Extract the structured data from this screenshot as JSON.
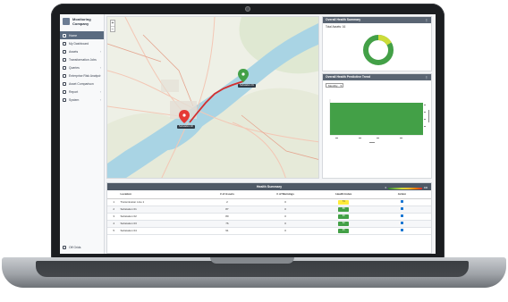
{
  "app": {
    "title": "Monitoring Company"
  },
  "sidebar": {
    "items": [
      {
        "label": "Home",
        "active": true,
        "has_children": false
      },
      {
        "label": "My Dashboard",
        "active": false,
        "has_children": false
      },
      {
        "label": "Assets",
        "active": false,
        "has_children": true
      },
      {
        "label": "Transformation Jobs",
        "active": false,
        "has_children": false
      },
      {
        "label": "Queries",
        "active": false,
        "has_children": true
      },
      {
        "label": "Enterprise Risk Analysis",
        "active": false,
        "has_children": true
      },
      {
        "label": "Asset Comparison",
        "active": false,
        "has_children": false
      },
      {
        "label": "Report",
        "active": false,
        "has_children": true
      },
      {
        "label": "System",
        "active": false,
        "has_children": true
      }
    ],
    "footer_label": "Off Grids"
  },
  "map": {
    "zoom_in": "+",
    "zoom_out": "−",
    "pins": [
      {
        "label": "Substation 01",
        "color": "#43a047"
      },
      {
        "label": "Substation 02",
        "color": "#e53935"
      }
    ]
  },
  "health_summary_card": {
    "title": "Overall Health Summary",
    "caption": "Total Assets: 16",
    "menu_icon": "more-icon",
    "donut": {
      "good": 13,
      "fair": 3,
      "colors": {
        "good": "#43a047",
        "fair": "#cddc39"
      }
    }
  },
  "health_trend_card": {
    "title": "Overall Health Predictive Trend",
    "menu_icon": "more-icon",
    "select_value": "Monthly",
    "bar_color": "#43a047"
  },
  "health_table": {
    "title": "Health Summary",
    "columns": [
      "",
      "Location",
      "# of Assets",
      "# of Warnings",
      "Health Index",
      "Action"
    ],
    "rows": [
      {
        "n": "1",
        "location": "Transmission Line 1",
        "assets": "2",
        "warnings": "0",
        "index": "74",
        "status": "yellow"
      },
      {
        "n": "2",
        "location": "Substation 01",
        "assets": "87",
        "warnings": "0",
        "index": "88",
        "status": "green"
      },
      {
        "n": "3",
        "location": "Substation 02",
        "assets": "80",
        "warnings": "0",
        "index": "90",
        "status": "green"
      },
      {
        "n": "4",
        "location": "Substation 03",
        "assets": "76",
        "warnings": "0",
        "index": "92",
        "status": "green"
      },
      {
        "n": "5",
        "location": "Substation 04",
        "assets": "91",
        "warnings": "0",
        "index": "95",
        "status": "green"
      }
    ],
    "legend_low": "0",
    "legend_high": "100"
  }
}
